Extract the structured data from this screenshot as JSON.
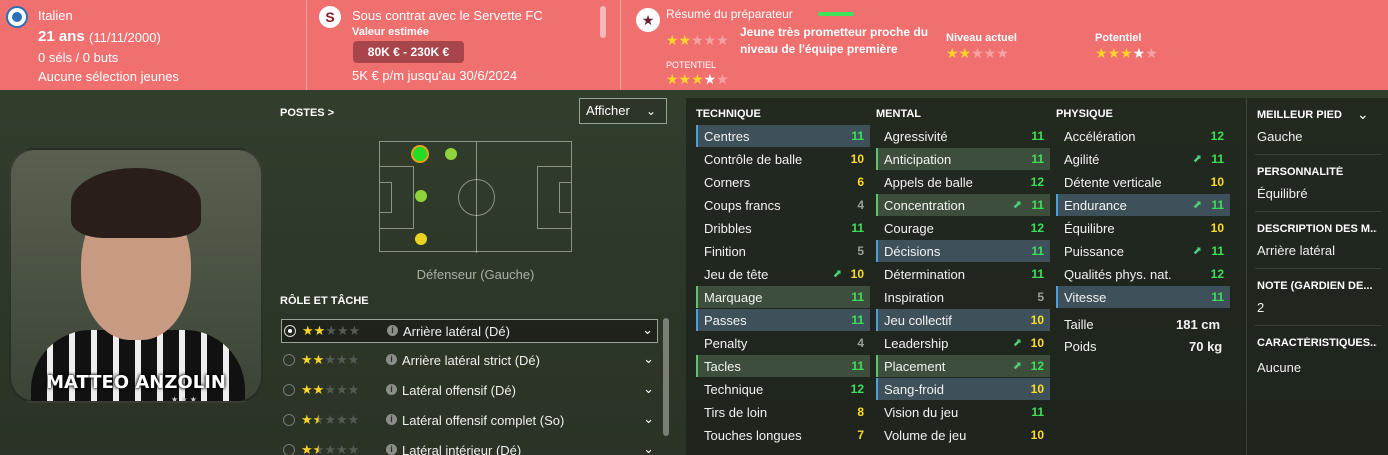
{
  "header": {
    "nationality": "Italien",
    "age": "21 ans",
    "dob": "(11/11/2000)",
    "caps": "0 séls / 0 buts",
    "youth_selection": "Aucune sélection jeunes",
    "contract": "Sous contrat avec le Servette FC",
    "value_label": "Valeur estimée",
    "value_range": "80K € - 230K €",
    "wage": "5K € p/m jusqu'au 30/6/2024",
    "scout_summary": "Résumé du préparateur",
    "scout_comment_line1": "Jeune très prometteur proche du",
    "scout_comment_line2": "niveau de l'équipe première",
    "potential_small_label": "POTENTIEL",
    "current_level_label": "Niveau actuel",
    "potential_label": "Potentiel",
    "club_icon_glyph": "S",
    "scout_icon_glyph": "★",
    "colors": {
      "banner": "#f07070",
      "star": "#ffd428"
    }
  },
  "player": {
    "name": "MATTEO ANZOLIN",
    "shirt_stars": "★ ★ ★"
  },
  "positions": {
    "title": "POSTES",
    "title_chevron": ">",
    "show_button": "Afficher",
    "show_chevron": "⌄",
    "caption": "Défenseur (Gauche)"
  },
  "roles": {
    "title": "RÔLE ET TÂCHE",
    "info_glyph": "i",
    "chevron": "⌄",
    "items": [
      {
        "label": "Arrière latéral (Dé)",
        "stars": 2,
        "selected": true
      },
      {
        "label": "Arrière latéral strict (Dé)",
        "stars": 2,
        "selected": false
      },
      {
        "label": "Latéral offensif (Dé)",
        "stars": 2,
        "selected": false
      },
      {
        "label": "Latéral offensif complet (So)",
        "stars": 1.5,
        "selected": false
      },
      {
        "label": "Latéral intérieur (Dé)",
        "stars": 1.5,
        "selected": false
      }
    ]
  },
  "attributes": {
    "technique": {
      "title": "TECHNIQUE",
      "items": [
        {
          "name": "Centres",
          "value": "11",
          "color": "green",
          "hl": "blue",
          "trend": false
        },
        {
          "name": "Contrôle de balle",
          "value": "10",
          "color": "yellow",
          "hl": "",
          "trend": false
        },
        {
          "name": "Corners",
          "value": "6",
          "color": "yellow",
          "hl": "",
          "trend": false
        },
        {
          "name": "Coups francs",
          "value": "4",
          "color": "grey",
          "hl": "",
          "trend": false
        },
        {
          "name": "Dribbles",
          "value": "11",
          "color": "green",
          "hl": "",
          "trend": false
        },
        {
          "name": "Finition",
          "value": "5",
          "color": "grey",
          "hl": "",
          "trend": false
        },
        {
          "name": "Jeu de tête",
          "value": "10",
          "color": "yellow",
          "hl": "",
          "trend": true
        },
        {
          "name": "Marquage",
          "value": "11",
          "color": "green",
          "hl": "green",
          "trend": false
        },
        {
          "name": "Passes",
          "value": "11",
          "color": "green",
          "hl": "blue",
          "trend": false
        },
        {
          "name": "Penalty",
          "value": "4",
          "color": "grey",
          "hl": "",
          "trend": false
        },
        {
          "name": "Tacles",
          "value": "11",
          "color": "green",
          "hl": "green",
          "trend": false
        },
        {
          "name": "Technique",
          "value": "12",
          "color": "green",
          "hl": "",
          "trend": false
        },
        {
          "name": "Tirs de loin",
          "value": "8",
          "color": "yellow",
          "hl": "",
          "trend": false
        },
        {
          "name": "Touches longues",
          "value": "7",
          "color": "yellow",
          "hl": "",
          "trend": false
        }
      ]
    },
    "mental": {
      "title": "MENTAL",
      "items": [
        {
          "name": "Agressivité",
          "value": "11",
          "color": "green",
          "hl": "",
          "trend": false
        },
        {
          "name": "Anticipation",
          "value": "11",
          "color": "green",
          "hl": "green",
          "trend": false
        },
        {
          "name": "Appels de balle",
          "value": "12",
          "color": "green",
          "hl": "",
          "trend": false
        },
        {
          "name": "Concentration",
          "value": "11",
          "color": "green",
          "hl": "green",
          "trend": true
        },
        {
          "name": "Courage",
          "value": "12",
          "color": "green",
          "hl": "",
          "trend": false
        },
        {
          "name": "Décisions",
          "value": "11",
          "color": "green",
          "hl": "blue",
          "trend": false
        },
        {
          "name": "Détermination",
          "value": "11",
          "color": "green",
          "hl": "",
          "trend": false
        },
        {
          "name": "Inspiration",
          "value": "5",
          "color": "grey",
          "hl": "",
          "trend": false
        },
        {
          "name": "Jeu collectif",
          "value": "10",
          "color": "yellow",
          "hl": "blue",
          "trend": false
        },
        {
          "name": "Leadership",
          "value": "10",
          "color": "yellow",
          "hl": "",
          "trend": true
        },
        {
          "name": "Placement",
          "value": "12",
          "color": "green",
          "hl": "green",
          "trend": true
        },
        {
          "name": "Sang-froid",
          "value": "10",
          "color": "yellow",
          "hl": "blue",
          "trend": false
        },
        {
          "name": "Vision du jeu",
          "value": "11",
          "color": "green",
          "hl": "",
          "trend": false
        },
        {
          "name": "Volume de jeu",
          "value": "10",
          "color": "yellow",
          "hl": "",
          "trend": false
        }
      ]
    },
    "physique": {
      "title": "PHYSIQUE",
      "items": [
        {
          "name": "Accélération",
          "value": "12",
          "color": "green",
          "hl": "",
          "trend": false
        },
        {
          "name": "Agilité",
          "value": "11",
          "color": "green",
          "hl": "",
          "trend": true
        },
        {
          "name": "Détente verticale",
          "value": "10",
          "color": "yellow",
          "hl": "",
          "trend": false
        },
        {
          "name": "Endurance",
          "value": "11",
          "color": "green",
          "hl": "blue",
          "trend": true
        },
        {
          "name": "Équilibre",
          "value": "10",
          "color": "yellow",
          "hl": "",
          "trend": false
        },
        {
          "name": "Puissance",
          "value": "11",
          "color": "green",
          "hl": "",
          "trend": true
        },
        {
          "name": "Qualités phys. nat.",
          "value": "12",
          "color": "green",
          "hl": "",
          "trend": false
        },
        {
          "name": "Vitesse",
          "value": "11",
          "color": "green",
          "hl": "blue",
          "trend": false
        }
      ],
      "height_label": "Taille",
      "height_value": "181 cm",
      "weight_label": "Poids",
      "weight_value": "70 kg"
    }
  },
  "info": {
    "best_foot_title": "MEILLEUR PIED",
    "best_foot": "Gauche",
    "expand_chevron": "⌄",
    "personality_title": "PERSONNALITÉ",
    "personality": "Équilibré",
    "media_title": "DESCRIPTION DES M...",
    "media": "Arrière latéral",
    "gk_title": "NOTE (GARDIEN DE...",
    "gk": "2",
    "traits_title": "CARACTÉRISTIQUES...",
    "traits": "Aucune"
  }
}
